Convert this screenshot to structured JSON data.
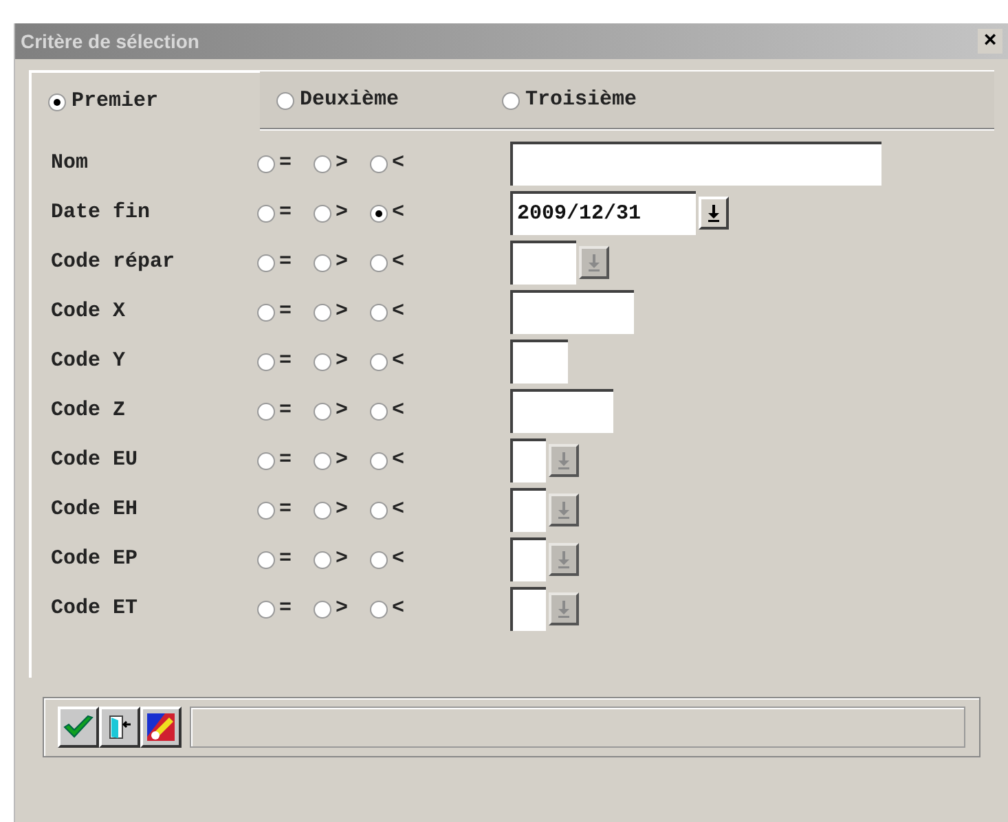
{
  "window": {
    "title": "Critère de sélection",
    "close": "×"
  },
  "tabs": [
    {
      "label": "Premier",
      "selected": true
    },
    {
      "label": "Deuxième",
      "selected": false
    },
    {
      "label": "Troisième",
      "selected": false
    }
  ],
  "rows": [
    {
      "label": "Nom",
      "operators": [
        {
          "symbol": "=",
          "selected": false
        },
        {
          "symbol": ">",
          "selected": false
        },
        {
          "symbol": "<",
          "selected": false
        }
      ],
      "field": {
        "kind": "text"
      }
    },
    {
      "label": "Date fin",
      "operators": [
        {
          "symbol": "=",
          "selected": false
        },
        {
          "symbol": ">",
          "selected": false
        },
        {
          "symbol": "<",
          "selected": true
        }
      ],
      "field": {
        "kind": "dropdown",
        "value": "2009/12/31",
        "disabled": false
      }
    },
    {
      "label": "Code répar",
      "operators": [
        {
          "symbol": "=",
          "selected": false
        },
        {
          "symbol": ">",
          "selected": false
        },
        {
          "symbol": "<",
          "selected": false
        }
      ],
      "field": {
        "kind": "dropdown",
        "disabled": true
      }
    },
    {
      "label": "Code X",
      "operators": [
        {
          "symbol": "=",
          "selected": false
        },
        {
          "symbol": ">",
          "selected": false
        },
        {
          "symbol": "<",
          "selected": false
        }
      ],
      "field": {
        "kind": "text"
      }
    },
    {
      "label": "Code Y",
      "operators": [
        {
          "symbol": "=",
          "selected": false
        },
        {
          "symbol": ">",
          "selected": false
        },
        {
          "symbol": "<",
          "selected": false
        }
      ],
      "field": {
        "kind": "text"
      }
    },
    {
      "label": "Code Z",
      "operators": [
        {
          "symbol": "=",
          "selected": false
        },
        {
          "symbol": ">",
          "selected": false
        },
        {
          "symbol": "<",
          "selected": false
        }
      ],
      "field": {
        "kind": "text"
      }
    },
    {
      "label": "Code EU",
      "operators": [
        {
          "symbol": "=",
          "selected": false
        },
        {
          "symbol": ">",
          "selected": false
        },
        {
          "symbol": "<",
          "selected": false
        }
      ],
      "field": {
        "kind": "dropdown",
        "disabled": true
      }
    },
    {
      "label": "Code EH",
      "operators": [
        {
          "symbol": "=",
          "selected": false
        },
        {
          "symbol": ">",
          "selected": false
        },
        {
          "symbol": "<",
          "selected": false
        }
      ],
      "field": {
        "kind": "dropdown",
        "disabled": true
      }
    },
    {
      "label": "Code EP",
      "operators": [
        {
          "symbol": "=",
          "selected": false
        },
        {
          "symbol": ">",
          "selected": false
        },
        {
          "symbol": "<",
          "selected": false
        }
      ],
      "field": {
        "kind": "dropdown",
        "disabled": true
      }
    },
    {
      "label": "Code ET",
      "operators": [
        {
          "symbol": "=",
          "selected": false
        },
        {
          "symbol": ">",
          "selected": false
        },
        {
          "symbol": "<",
          "selected": false
        }
      ],
      "field": {
        "kind": "dropdown",
        "disabled": true
      }
    }
  ]
}
